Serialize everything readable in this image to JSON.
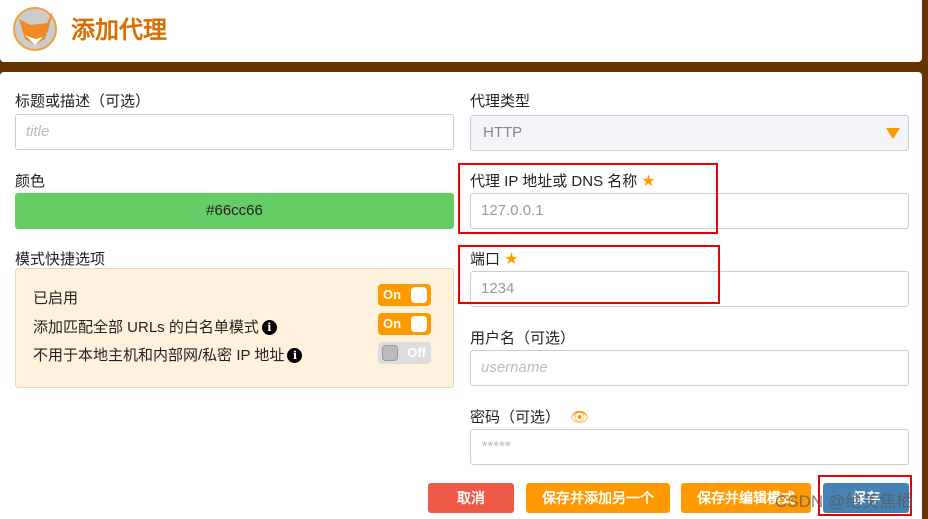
{
  "header": {
    "title": "添加代理",
    "logo": "fox-logo"
  },
  "left": {
    "title_label": "标题或描述（可选）",
    "title_placeholder": "title",
    "color_label": "颜色",
    "color_value": "#66cc66",
    "quick_label": "模式快捷选项",
    "options": [
      {
        "label": "已启用",
        "state": "On",
        "on": true,
        "info": false
      },
      {
        "label": "添加匹配全部 URLs 的白名单模式",
        "state": "On",
        "on": true,
        "info": true
      },
      {
        "label": "不用于本地主机和内部网/私密 IP 地址",
        "state": "Off",
        "on": false,
        "info": true
      }
    ]
  },
  "right": {
    "type_label": "代理类型",
    "type_value": "HTTP",
    "host_label": "代理 IP 地址或 DNS 名称",
    "host_value": "127.0.0.1",
    "port_label": "端口",
    "port_value": "1234",
    "user_label": "用户名（可选）",
    "user_placeholder": "username",
    "pass_label": "密码（可选）",
    "pass_placeholder": "*****"
  },
  "buttons": {
    "cancel": "取消",
    "save_add": "保存并添加另一个",
    "save_edit": "保存并编辑模式",
    "save": "保存"
  },
  "watermark": "CSDN @绝美焦栖",
  "colors": {
    "accent": "#ff9900",
    "brand": "#663300",
    "cancel": "#ee5a45",
    "save": "#4682b4"
  }
}
